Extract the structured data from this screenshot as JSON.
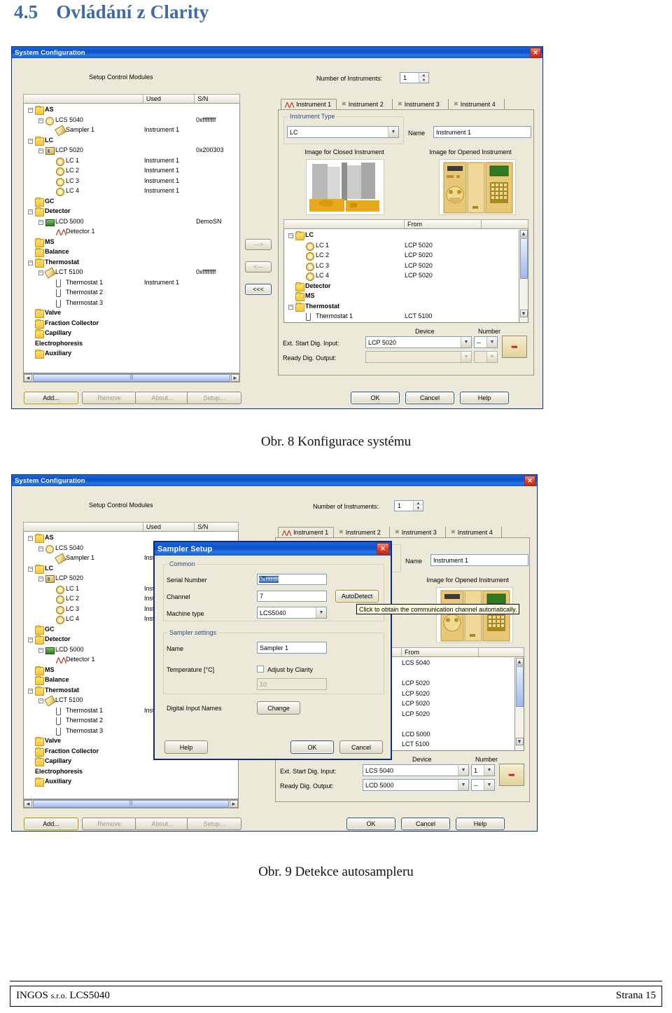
{
  "heading": {
    "number": "4.5",
    "text": "Ovládání z Clarity"
  },
  "figures": [
    {
      "caption": "Obr. 8 Konfigurace systému"
    },
    {
      "caption": "Obr. 9 Detekce autosampleru"
    }
  ],
  "footer": {
    "left_main": "INGOS",
    "left_small": "s.r.o.",
    "left_tail": "LCS5040",
    "right": "Strana 15"
  },
  "dialog": {
    "title": "System Configuration",
    "close_label": "✕",
    "setup_label": "Setup Control Modules",
    "num_instruments_label": "Number of Instruments:",
    "num_instruments_value": "1",
    "list_headers": [
      "",
      "Used",
      "S/N"
    ],
    "tree": [
      {
        "label": "AS",
        "indent": 0,
        "icon": "folder",
        "bold": true,
        "expander": "-",
        "used": "",
        "sn": ""
      },
      {
        "label": "LCS 5040",
        "indent": 1,
        "icon": "gear",
        "bold": false,
        "expander": "-",
        "used": "",
        "sn": "0xffffffff"
      },
      {
        "label": "Sampler 1",
        "indent": 2,
        "icon": "pen",
        "bold": false,
        "expander": "",
        "used": "Instrument 1",
        "sn": ""
      },
      {
        "label": "LC",
        "indent": 0,
        "icon": "folder",
        "bold": true,
        "expander": "-",
        "used": "",
        "sn": ""
      },
      {
        "label": "LCP 5020",
        "indent": 1,
        "icon": "chip",
        "bold": false,
        "expander": "-",
        "used": "",
        "sn": "0x200303"
      },
      {
        "label": "LC 1",
        "indent": 2,
        "icon": "flower",
        "bold": false,
        "expander": "",
        "used": "Instrument 1",
        "sn": ""
      },
      {
        "label": "LC 2",
        "indent": 2,
        "icon": "flower",
        "bold": false,
        "expander": "",
        "used": "Instrument 1",
        "sn": ""
      },
      {
        "label": "LC 3",
        "indent": 2,
        "icon": "flower",
        "bold": false,
        "expander": "",
        "used": "Instrument 1",
        "sn": ""
      },
      {
        "label": "LC 4",
        "indent": 2,
        "icon": "flower",
        "bold": false,
        "expander": "",
        "used": "Instrument 1",
        "sn": ""
      },
      {
        "label": "GC",
        "indent": 0,
        "icon": "folder",
        "bold": true,
        "expander": "",
        "used": "",
        "sn": ""
      },
      {
        "label": "Detector",
        "indent": 0,
        "icon": "folder",
        "bold": true,
        "expander": "-",
        "used": "",
        "sn": ""
      },
      {
        "label": "LCD 5000",
        "indent": 1,
        "icon": "greenbox",
        "bold": false,
        "expander": "-",
        "used": "",
        "sn": "DemoSN"
      },
      {
        "label": "Detector 1",
        "indent": 2,
        "icon": "peaks",
        "bold": false,
        "expander": "",
        "used": "",
        "sn": ""
      },
      {
        "label": "MS",
        "indent": 0,
        "icon": "folder",
        "bold": true,
        "expander": "",
        "used": "",
        "sn": ""
      },
      {
        "label": "Balance",
        "indent": 0,
        "icon": "folder",
        "bold": true,
        "expander": "",
        "used": "",
        "sn": ""
      },
      {
        "label": "Thermostat",
        "indent": 0,
        "icon": "folder",
        "bold": true,
        "expander": "-",
        "used": "",
        "sn": ""
      },
      {
        "label": "LCT 5100",
        "indent": 1,
        "icon": "pen",
        "bold": false,
        "expander": "-",
        "used": "",
        "sn": "0xffffffff"
      },
      {
        "label": "Thermostat 1",
        "indent": 2,
        "icon": "tube",
        "bold": false,
        "expander": "",
        "used": "Instrument 1",
        "sn": ""
      },
      {
        "label": "Thermostat 2",
        "indent": 2,
        "icon": "tube",
        "bold": false,
        "expander": "",
        "used": "",
        "sn": ""
      },
      {
        "label": "Thermostat 3",
        "indent": 2,
        "icon": "tube",
        "bold": false,
        "expander": "",
        "used": "",
        "sn": ""
      },
      {
        "label": "Valve",
        "indent": 0,
        "icon": "folder",
        "bold": true,
        "expander": "",
        "used": "",
        "sn": ""
      },
      {
        "label": "Fraction Collector",
        "indent": 0,
        "icon": "folder",
        "bold": true,
        "expander": "",
        "used": "",
        "sn": ""
      },
      {
        "label": "Capillary",
        "indent": 0,
        "icon": "folder",
        "bold": true,
        "expander": "",
        "used": "",
        "sn": ""
      },
      {
        "label": "Electrophoresis",
        "indent": 0,
        "icon": "none",
        "bold": true,
        "expander": "",
        "used": "",
        "sn": ""
      },
      {
        "label": "Auxiliary",
        "indent": 0,
        "icon": "folder",
        "bold": true,
        "expander": "",
        "used": "",
        "sn": ""
      }
    ],
    "transfer_buttons": [
      {
        "label": "--->",
        "enabled": false
      },
      {
        "label": "<---",
        "enabled": false
      },
      {
        "label": "<<<",
        "enabled": true
      }
    ],
    "tabs": [
      {
        "label": "Instrument 1",
        "mark": "peaks",
        "active": true
      },
      {
        "label": "Instrument 2",
        "mark": "closed",
        "active": false
      },
      {
        "label": "Instrument 3",
        "mark": "closed",
        "active": false
      },
      {
        "label": "Instrument 4",
        "mark": "closed",
        "active": false
      }
    ],
    "instrument_type_label": "Instrument Type",
    "instrument_type_value": "LC",
    "name_label": "Name",
    "name_value": "Instrument 1",
    "image_closed_label": "Image for Closed Instrument",
    "image_opened_label": "Image for Opened Instrument",
    "from_header": "From",
    "from_tree": [
      {
        "label": "LC",
        "indent": 0,
        "icon": "folder",
        "bold": true,
        "expander": "-",
        "from": ""
      },
      {
        "label": "LC 1",
        "indent": 1,
        "icon": "flower",
        "bold": false,
        "expander": "",
        "from": "LCP 5020"
      },
      {
        "label": "LC 2",
        "indent": 1,
        "icon": "flower",
        "bold": false,
        "expander": "",
        "from": "LCP 5020"
      },
      {
        "label": "LC 3",
        "indent": 1,
        "icon": "flower",
        "bold": false,
        "expander": "",
        "from": "LCP 5020"
      },
      {
        "label": "LC 4",
        "indent": 1,
        "icon": "flower",
        "bold": false,
        "expander": "",
        "from": "LCP 5020"
      },
      {
        "label": "Detector",
        "indent": 0,
        "icon": "folder",
        "bold": true,
        "expander": "",
        "from": ""
      },
      {
        "label": "MS",
        "indent": 0,
        "icon": "folder",
        "bold": true,
        "expander": "",
        "from": ""
      },
      {
        "label": "Thermostat",
        "indent": 0,
        "icon": "folder",
        "bold": true,
        "expander": "-",
        "from": ""
      },
      {
        "label": "Thermostat 1",
        "indent": 1,
        "icon": "tube",
        "bold": false,
        "expander": "",
        "from": "LCT 5100"
      }
    ],
    "device_label": "Device",
    "number_label": "Number",
    "ext_start_label": "Ext. Start Dig. Input:",
    "ext_start_device": "LCP 5020",
    "ext_start_number": "--",
    "ready_out_label": "Ready Dig. Output:",
    "ready_out_device": "",
    "ready_out_number": "",
    "left_buttons": [
      {
        "label": "Add...",
        "enabled": true,
        "focus": true
      },
      {
        "label": "Remove",
        "enabled": false,
        "focus": false
      },
      {
        "label": "About...",
        "enabled": false,
        "focus": false
      },
      {
        "label": "Setup...",
        "enabled": false,
        "focus": false
      }
    ],
    "right_buttons": [
      {
        "label": "OK",
        "default": true
      },
      {
        "label": "Cancel",
        "default": true
      },
      {
        "label": "Help",
        "default": true
      }
    ]
  },
  "dialog2_overrides": {
    "from_rows": [
      "LCS 5040",
      "",
      "LCP 5020",
      "LCP 5020",
      "LCP 5020",
      "LCP 5020",
      "",
      "LCD 5000"
    ],
    "ext_start_device": "LCS 5040",
    "ext_start_number": "1",
    "ready_out_device": "LCD 5000",
    "ready_out_number": "--"
  },
  "sampler_setup": {
    "title": "Sampler Setup",
    "close_label": "✕",
    "common_label": "Common",
    "serial_label": "Serial Number",
    "serial_value": "0xffffffff",
    "channel_label": "Channel",
    "channel_value": "7",
    "autodetect_label": "AutoDetect",
    "machine_label": "Machine type",
    "machine_value": "LCS5040",
    "settings_label": "Sampler settings",
    "name_label": "Name",
    "name_value": "Sampler 1",
    "temperature_label": "Temperature [°C]",
    "adjust_label": "Adjust by Clarity",
    "adjust_checked": false,
    "temperature_value": "10",
    "digital_input_label": "Digital Input Names",
    "change_label": "Change",
    "help_label": "Help",
    "ok_label": "OK",
    "cancel_label": "Cancel",
    "tooltip": "Click to obtain the communication channel automatically."
  }
}
